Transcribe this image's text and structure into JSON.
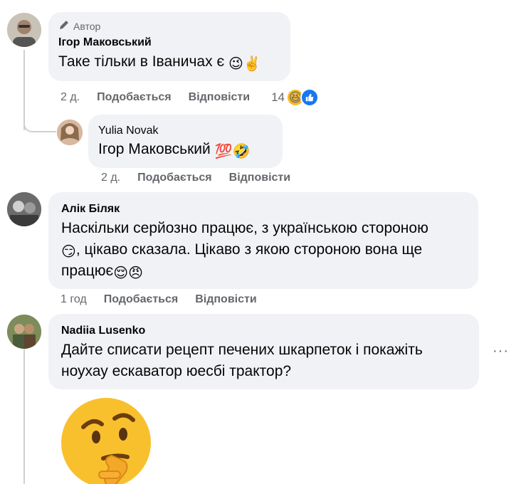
{
  "comments": [
    {
      "badge": "Автор",
      "name": "Ігор Маковський",
      "text": "Таке тільки в Іваничах є",
      "emojis": "😉✌️",
      "time": "2 д.",
      "like_label": "Подобається",
      "reply_label": "Відповісти",
      "reaction_count": "14"
    },
    {
      "name": "Yulia Novak",
      "text": "Ігор Маковський",
      "emojis": "💯🤣",
      "time": "2 д.",
      "like_label": "Подобається",
      "reply_label": "Відповісти"
    },
    {
      "name": "Алік Біляк",
      "text_line1": "Наскільки серйозно працює, з українською стороною",
      "text_line2": ", цікаво сказала. Цікаво з якою стороною вона ще",
      "text_line3": "працює",
      "emoji_inline": "😏",
      "emojis_end": "😌😠",
      "time": "1 год",
      "like_label": "Подобається",
      "reply_label": "Відповісти"
    },
    {
      "name": "Nadiia Lusenko",
      "text_line1": "Дайте списати рецепт печених шкарпеток і покажіть",
      "text_line2": "ноухау ескаватор юесбі трактор?",
      "more": "···",
      "sticker": "🤔"
    }
  ],
  "icons": {
    "badge_icon": "pencil-icon",
    "reaction_1": "laughing-emoji",
    "reaction_2": "like-icon"
  },
  "colors": {
    "bubble": "#f0f2f5",
    "secondary_text": "#65676b",
    "like_blue": "#1877f2"
  }
}
